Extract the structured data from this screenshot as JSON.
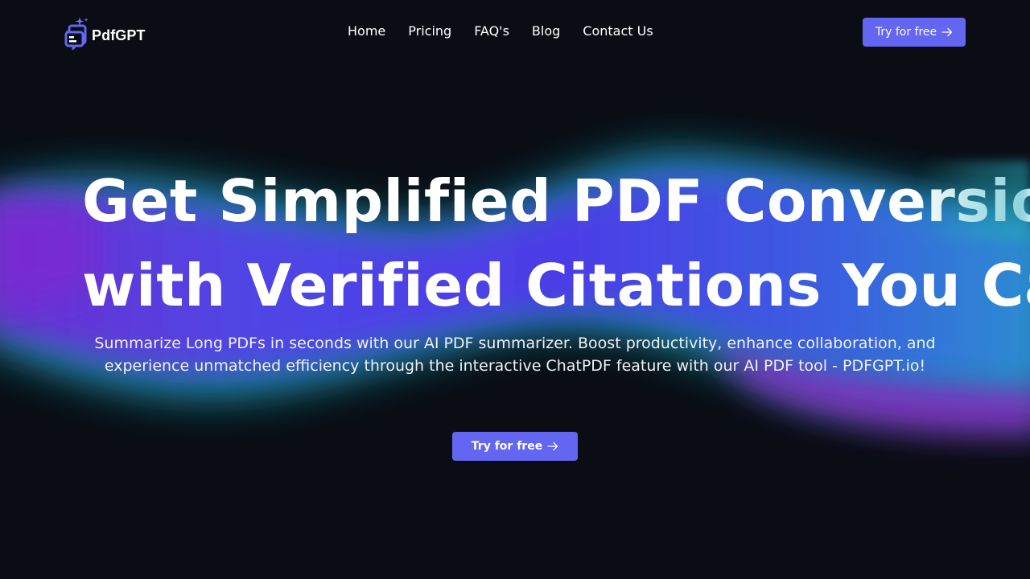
{
  "brand": {
    "name": "PdfGPT",
    "accent_color": "#6366f1",
    "logo_icon": "pdf-chat-sparkle-icon"
  },
  "nav": {
    "items": [
      {
        "label": "Home"
      },
      {
        "label": "Pricing"
      },
      {
        "label": "FAQ's"
      },
      {
        "label": "Blog"
      },
      {
        "label": "Contact Us"
      }
    ]
  },
  "header": {
    "cta_label": "Try for free",
    "cta_icon": "arrow-right-icon"
  },
  "hero": {
    "headline_line1": "Get Simplified PDF Conversion",
    "headline_line2": "with Verified Citations You Can Trust",
    "subtitle": "Summarize Long PDFs in seconds with our AI PDF summarizer. Boost productivity, enhance collaboration, and experience unmatched efficiency through the interactive ChatPDF feature with our AI PDF tool - PDFGPT.io!",
    "cta_label": "Try for free",
    "cta_icon": "arrow-right-icon"
  },
  "colors": {
    "background": "#0a0d14",
    "wave_purple": "#5b3be8",
    "wave_teal": "#1ba6b8",
    "wave_magenta": "#9b2fd0"
  }
}
